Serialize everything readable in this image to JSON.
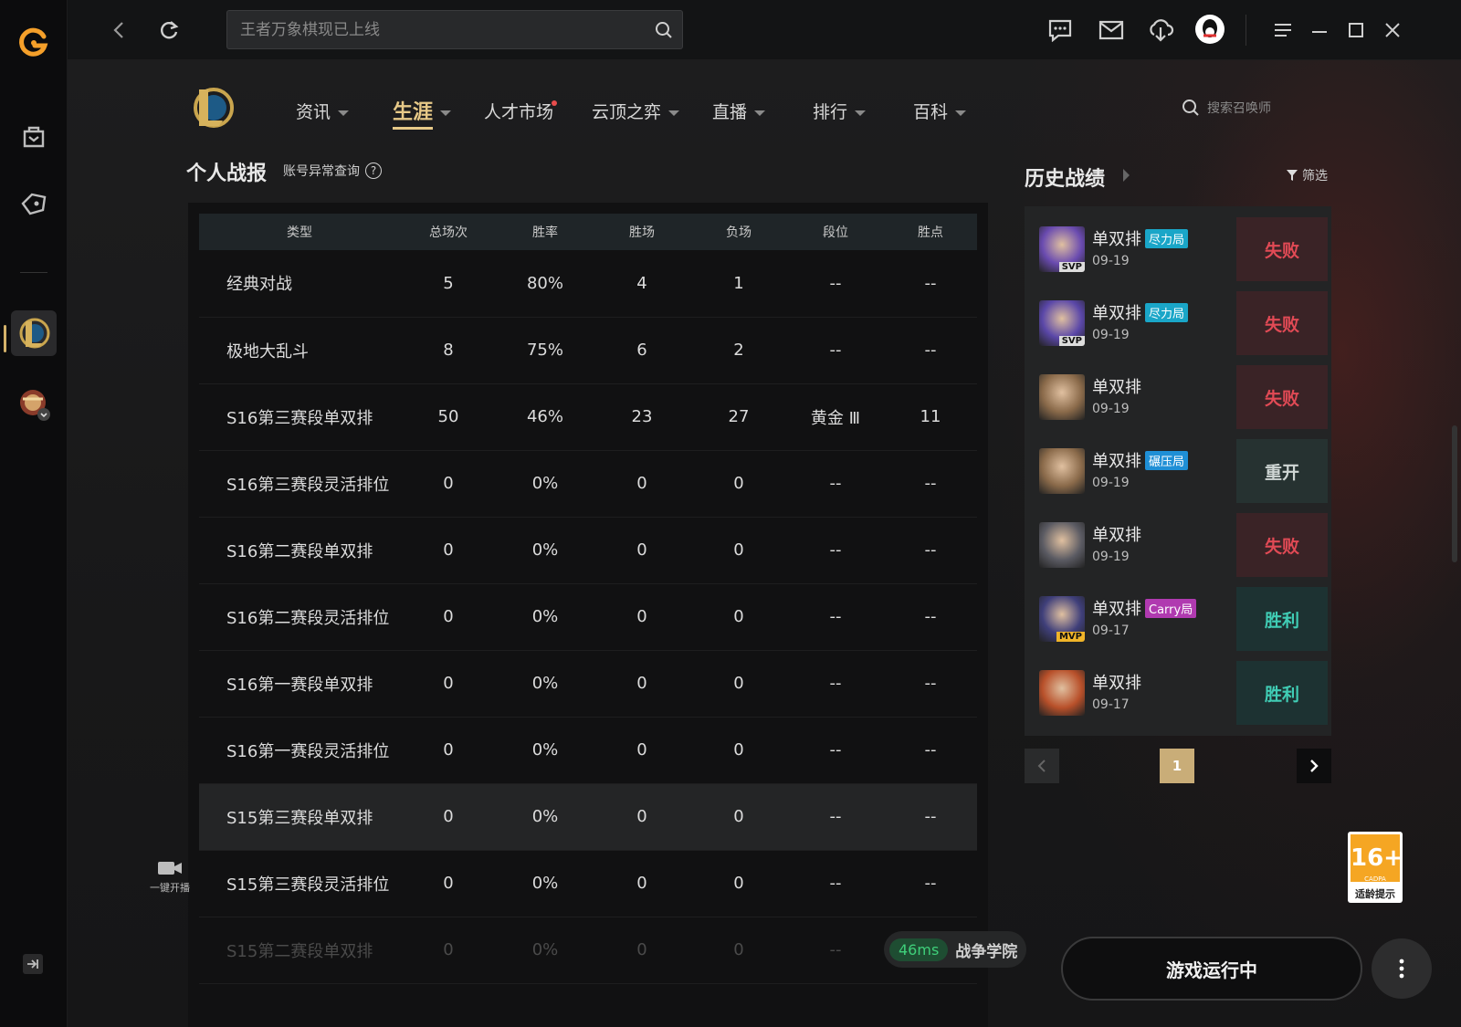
{
  "topbar": {
    "search_placeholder": "王者万象棋现已上线"
  },
  "nav": {
    "tabs": [
      {
        "label": "资讯"
      },
      {
        "label": "生涯"
      },
      {
        "label": "人才市场"
      },
      {
        "label": "云顶之弈"
      },
      {
        "label": "直播"
      },
      {
        "label": "排行"
      },
      {
        "label": "百科"
      }
    ],
    "search_summoner": "搜索召唤师"
  },
  "stats": {
    "title": "个人战报",
    "account_check": "账号异常查询",
    "help": "?",
    "columns": [
      "类型",
      "总场次",
      "胜率",
      "胜场",
      "负场",
      "段位",
      "胜点"
    ],
    "rows": [
      [
        "经典对战",
        "5",
        "80%",
        "4",
        "1",
        "--",
        "--"
      ],
      [
        "极地大乱斗",
        "8",
        "75%",
        "6",
        "2",
        "--",
        "--"
      ],
      [
        "S16第三赛段单双排",
        "50",
        "46%",
        "23",
        "27",
        "黄金 Ⅲ",
        "11"
      ],
      [
        "S16第三赛段灵活排位",
        "0",
        "0%",
        "0",
        "0",
        "--",
        "--"
      ],
      [
        "S16第二赛段单双排",
        "0",
        "0%",
        "0",
        "0",
        "--",
        "--"
      ],
      [
        "S16第二赛段灵活排位",
        "0",
        "0%",
        "0",
        "0",
        "--",
        "--"
      ],
      [
        "S16第一赛段单双排",
        "0",
        "0%",
        "0",
        "0",
        "--",
        "--"
      ],
      [
        "S16第一赛段灵活排位",
        "0",
        "0%",
        "0",
        "0",
        "--",
        "--"
      ],
      [
        "S15第三赛段单双排",
        "0",
        "0%",
        "0",
        "0",
        "--",
        "--"
      ],
      [
        "S15第三赛段灵活排位",
        "0",
        "0%",
        "0",
        "0",
        "--",
        "--"
      ],
      [
        "S15第二赛段单双排",
        "0",
        "0%",
        "0",
        "0",
        "--",
        "--"
      ]
    ]
  },
  "history": {
    "title": "历史战绩",
    "filter": "筛选",
    "matches": [
      {
        "mode": "单双排",
        "tag": "尽力局",
        "tag_color": "#1aa6c8",
        "date": "09-19",
        "result": "失败",
        "badge": "SVP",
        "avatar_color": "#6a4bb0"
      },
      {
        "mode": "单双排",
        "tag": "尽力局",
        "tag_color": "#1aa6c8",
        "date": "09-19",
        "result": "失败",
        "badge": "SVP",
        "avatar_color": "#5a47a8"
      },
      {
        "mode": "单双排",
        "tag": "",
        "tag_color": "",
        "date": "09-19",
        "result": "失败",
        "badge": "",
        "avatar_color": "#8a6a4a"
      },
      {
        "mode": "单双排",
        "tag": "碾压局",
        "tag_color": "#1f8fd6",
        "date": "09-19",
        "result": "重开",
        "badge": "",
        "avatar_color": "#8a6a4a"
      },
      {
        "mode": "单双排",
        "tag": "",
        "tag_color": "",
        "date": "09-19",
        "result": "失败",
        "badge": "",
        "avatar_color": "#5b5b63"
      },
      {
        "mode": "单双排",
        "tag": "Carry局",
        "tag_color": "#b03ab0",
        "date": "09-17",
        "result": "胜利",
        "badge": "MVP",
        "avatar_color": "#3f3f7a"
      },
      {
        "mode": "单双排",
        "tag": "",
        "tag_color": "",
        "date": "09-17",
        "result": "胜利",
        "badge": "",
        "avatar_color": "#b8502a"
      }
    ],
    "page": "1"
  },
  "sidebar": {
    "live_label": "一键开播"
  },
  "age_rating": {
    "value": "16+",
    "org": "CADPA",
    "hint": "适龄提示"
  },
  "footer": {
    "ping": "46ms",
    "academy": "战争学院",
    "run_status": "游戏运行中"
  },
  "colors": {
    "accent_gold": "#e7c988",
    "lose": "#e14a55",
    "win": "#40cdb5"
  }
}
